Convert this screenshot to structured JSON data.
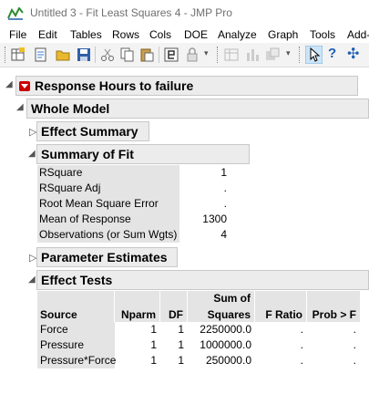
{
  "window": {
    "title": "Untitled 3 - Fit Least Squares 4 - JMP Pro"
  },
  "menu": [
    "File",
    "Edit",
    "Tables",
    "Rows",
    "Cols",
    "DOE",
    "Analyze",
    "Graph",
    "Tools",
    "Add-"
  ],
  "report": {
    "title": "Response Hours to failure",
    "whole_model": "Whole Model",
    "effect_summary": "Effect Summary",
    "summary_of_fit": {
      "title": "Summary of Fit",
      "rows": [
        {
          "label": "RSquare",
          "value": "1"
        },
        {
          "label": "RSquare Adj",
          "value": "."
        },
        {
          "label": "Root Mean Square Error",
          "value": "."
        },
        {
          "label": "Mean of Response",
          "value": "1300"
        },
        {
          "label": "Observations (or Sum Wgts)",
          "value": "4"
        }
      ]
    },
    "parameter_estimates": "Parameter Estimates",
    "effect_tests": {
      "title": "Effect Tests",
      "headers": {
        "source": "Source",
        "nparm": "Nparm",
        "df": "DF",
        "ss_line1": "Sum of",
        "ss_line2": "Squares",
        "fratio": "F Ratio",
        "prob": "Prob > F"
      },
      "rows": [
        {
          "source": "Force",
          "nparm": "1",
          "df": "1",
          "ss": "2250000.0",
          "fratio": ".",
          "prob": "."
        },
        {
          "source": "Pressure",
          "nparm": "1",
          "df": "1",
          "ss": "1000000.0",
          "fratio": ".",
          "prob": "."
        },
        {
          "source": "Pressure*Force",
          "nparm": "1",
          "df": "1",
          "ss": "250000.0",
          "fratio": ".",
          "prob": "."
        }
      ]
    }
  },
  "colors": {
    "accent_red": "#cc0000",
    "header_bg": "#ececec",
    "cell_bg": "#e4e4e4"
  }
}
